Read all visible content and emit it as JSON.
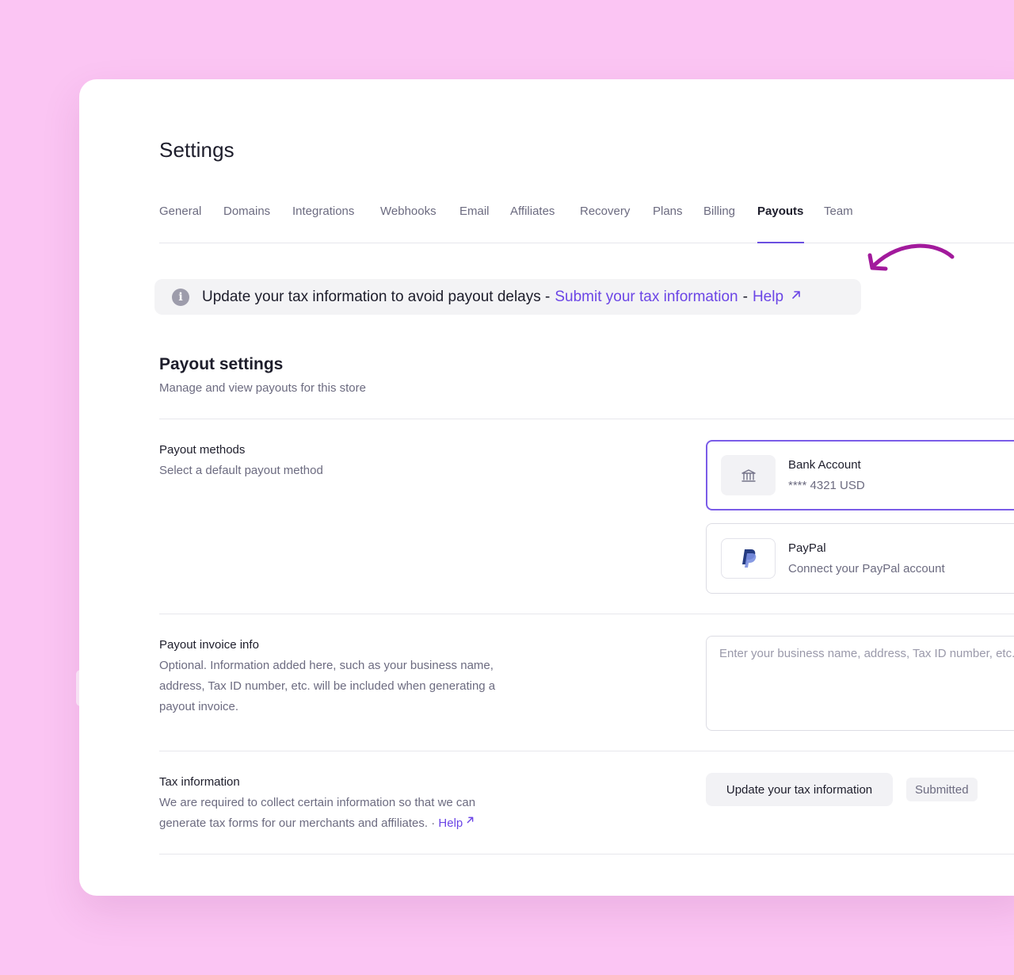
{
  "page": {
    "title": "Settings"
  },
  "tabs": [
    {
      "label": "General"
    },
    {
      "label": "Domains"
    },
    {
      "label": "Integrations"
    },
    {
      "label": "Webhooks"
    },
    {
      "label": "Email"
    },
    {
      "label": "Affiliates"
    },
    {
      "label": "Recovery"
    },
    {
      "label": "Plans"
    },
    {
      "label": "Billing"
    },
    {
      "label": "Payouts",
      "active": true
    },
    {
      "label": "Team"
    }
  ],
  "notice": {
    "text": "Update your tax information to avoid payout delays -",
    "submit_link": "Submit your tax information",
    "separator": "-",
    "help_link": "Help",
    "help_icon": "external-link-icon",
    "info_icon": "info-icon"
  },
  "payout_settings": {
    "title": "Payout settings",
    "subtitle": "Manage and view payouts for this store"
  },
  "payout_methods": {
    "label": "Payout methods",
    "description": "Select a default payout method",
    "methods": [
      {
        "name": "Bank Account",
        "detail": "**** 4321 USD",
        "icon": "bank-icon",
        "selected": true
      },
      {
        "name": "PayPal",
        "detail": "Connect your PayPal account",
        "icon": "paypal-icon",
        "selected": false
      }
    ]
  },
  "invoice_info": {
    "label": "Payout invoice info",
    "description": "Optional. Information added here, such as your business name, address, Tax ID number, etc. will be included when generating a payout invoice.",
    "placeholder": "Enter your business name, address, Tax ID number, etc."
  },
  "tax_info": {
    "label": "Tax information",
    "description": "We are required to collect certain information so that we can generate tax forms for our merchants and affiliates. ·",
    "help_link": "Help",
    "button": "Update your tax information",
    "status": "Submitted"
  },
  "colors": {
    "accent": "#6b45e6",
    "background": "#fbc5f3",
    "arrow": "#a21a9c"
  }
}
